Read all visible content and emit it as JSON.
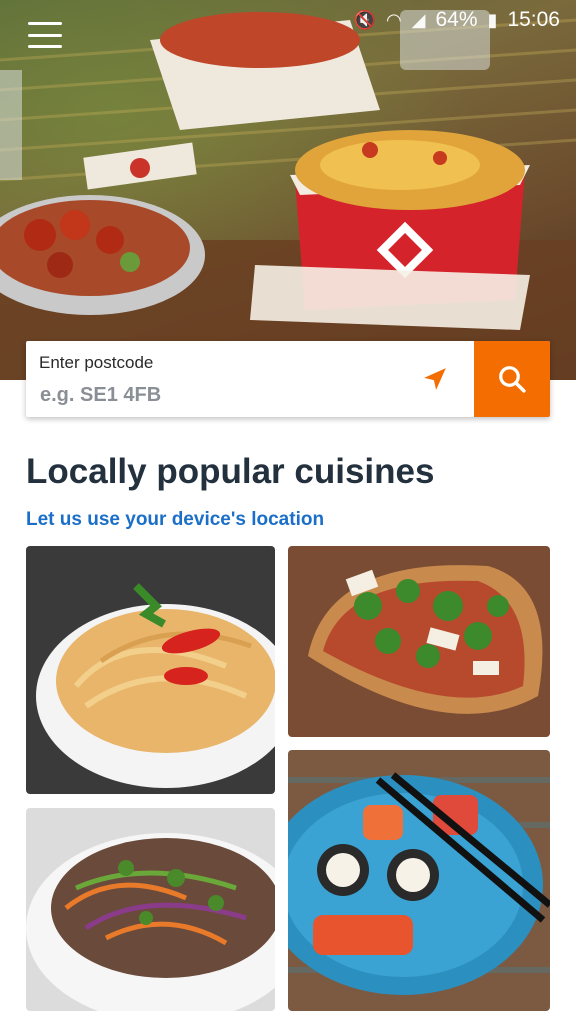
{
  "status_bar": {
    "battery": "64%",
    "time": "15:06"
  },
  "search": {
    "label": "Enter postcode",
    "placeholder": "e.g. SE1 4FB"
  },
  "section": {
    "title": "Locally popular cuisines",
    "location_link": "Let us use your device's location"
  },
  "colors": {
    "accent": "#f36d00",
    "link": "#1b6fc8",
    "heading": "#23303d"
  },
  "icons": [
    "menu-icon",
    "mute-icon",
    "wifi-icon",
    "signal-icon",
    "battery-icon",
    "location-arrow-icon",
    "search-icon"
  ],
  "cuisines": [
    {
      "id": "noodles"
    },
    {
      "id": "pizza"
    },
    {
      "id": "salad"
    },
    {
      "id": "sushi"
    }
  ]
}
